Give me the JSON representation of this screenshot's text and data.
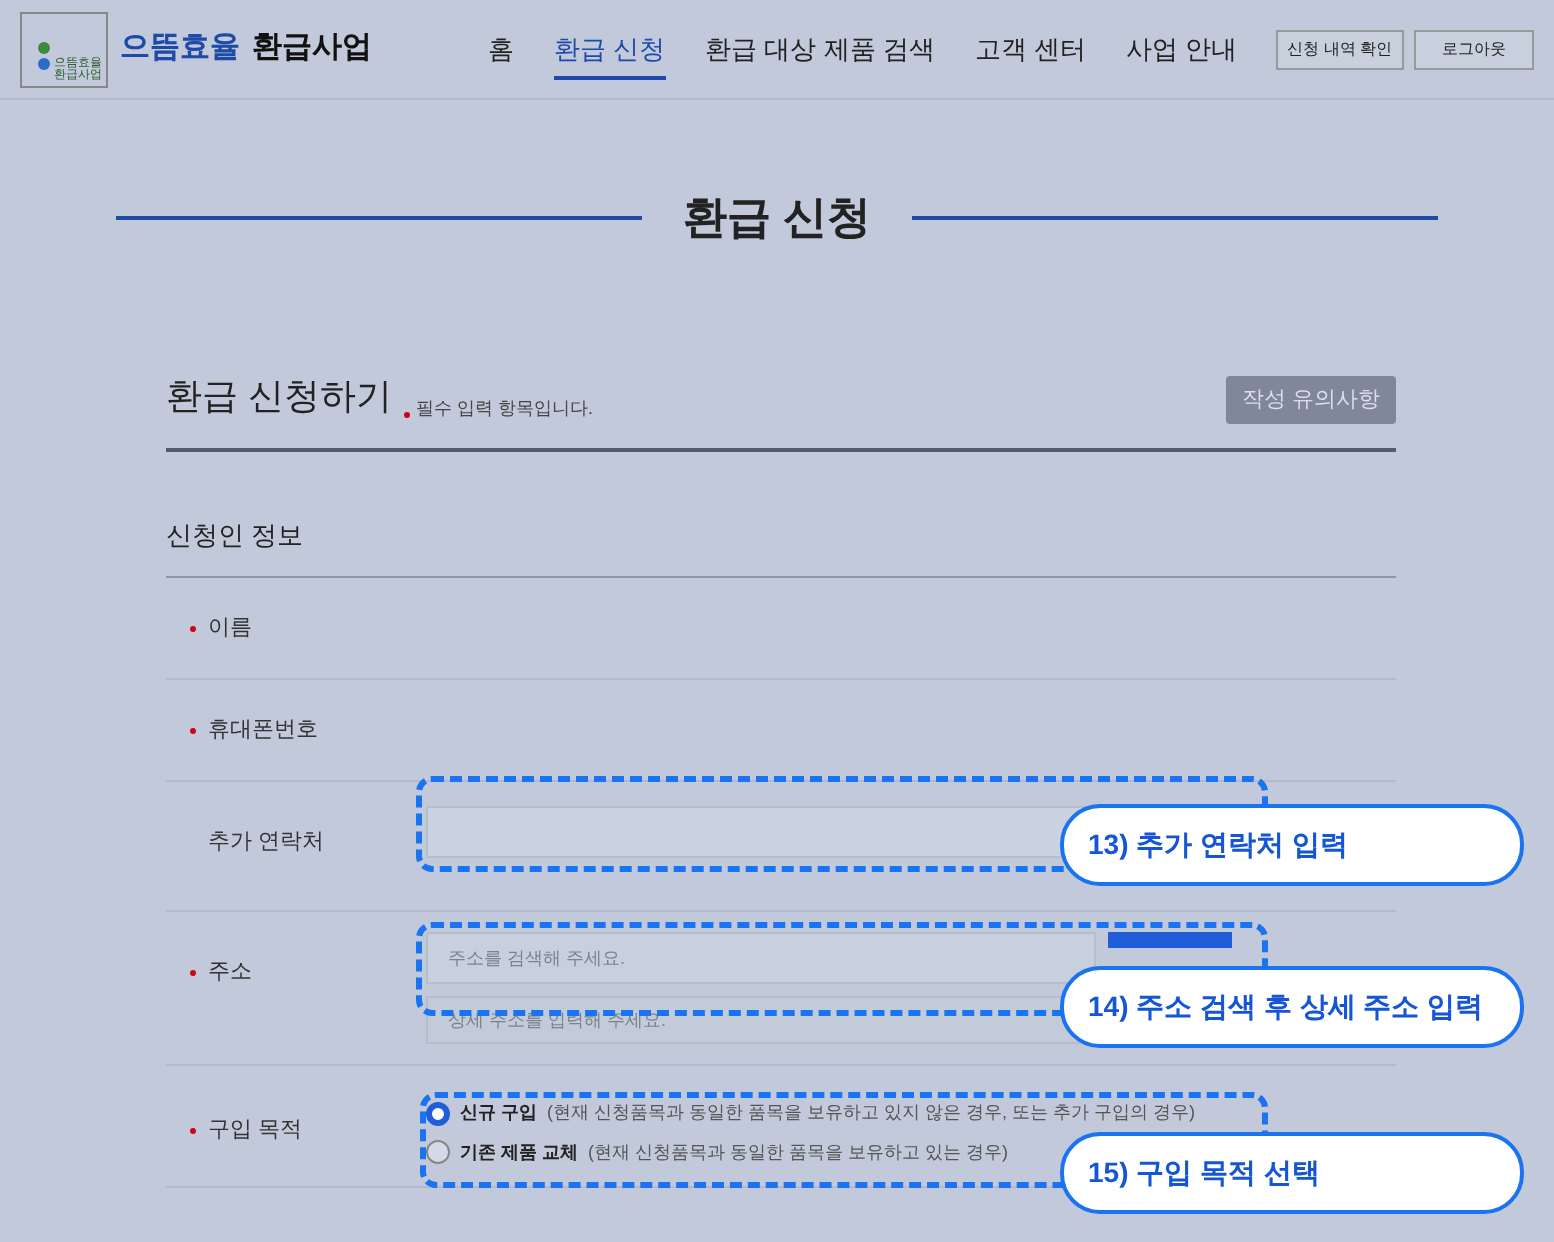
{
  "header": {
    "logo_text": "으뜸효율",
    "logo_subtext": "환급사업",
    "logo_badge": [
      "으뜸효율",
      "환급사업"
    ],
    "nav": [
      {
        "label": "홈",
        "selected": false
      },
      {
        "label": "환급 신청",
        "selected": true
      },
      {
        "label": "환급 대상 제품 검색",
        "selected": false
      },
      {
        "label": "고객 센터",
        "selected": false
      },
      {
        "label": "사업 안내",
        "selected": false
      }
    ],
    "buttons": [
      "신청 내역 확인",
      "로그아웃"
    ]
  },
  "page_title": "환급 신청",
  "form": {
    "title": "환급 신청하기",
    "required_note": "필수 입력 항목입니다.",
    "notice_button": "작성 유의사항",
    "section": "신청인 정보",
    "rows": [
      {
        "kind": "text",
        "label": "이름",
        "required": true
      },
      {
        "kind": "text",
        "label": "휴대폰번호",
        "required": true
      },
      {
        "kind": "contact",
        "label": "추가 연락처",
        "required": false
      },
      {
        "kind": "address",
        "label": "주소",
        "required": true,
        "placeholder": "주소를 검색해 주세요.",
        "detail_placeholder": "상세 주소를 입력해 주세요."
      },
      {
        "kind": "radio",
        "label": "구입 목적",
        "required": true,
        "options": [
          {
            "label": "신규 구입",
            "note": "(현재 신청품목과 동일한 품목을 보유하고 있지 않은 경우, 또는 추가 구입의 경우)",
            "selected": true
          },
          {
            "label": "기존 제품 교체",
            "note": "(현재 신청품목과 동일한 품목을 보유하고 있는 경우)",
            "selected": false
          }
        ]
      }
    ]
  },
  "callouts": [
    "13) 추가 연락처 입력",
    "14) 주소 검색 후 상세 주소 입력",
    "15) 구입 목적 선택"
  ]
}
